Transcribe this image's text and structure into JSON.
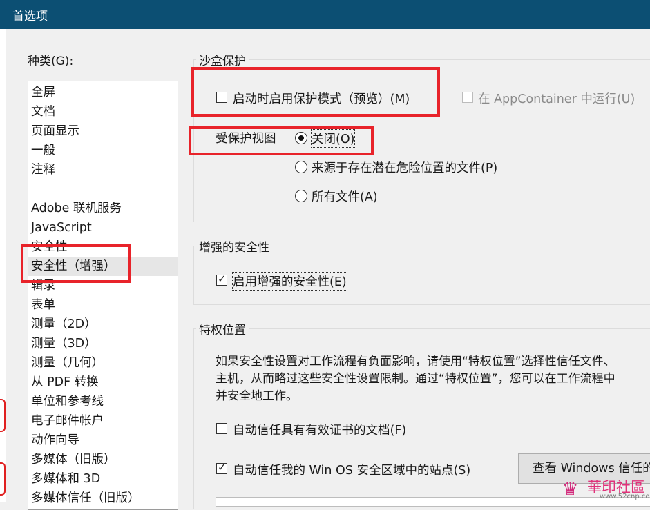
{
  "window": {
    "title": "首选项"
  },
  "categories": {
    "label": "种类(G):",
    "items": [
      "全屏",
      "文档",
      "页面显示",
      "一般",
      "注释",
      "Adobe 联机服务",
      "JavaScript",
      "安全性",
      "安全性（增强）",
      "辑录",
      "表单",
      "测量（2D）",
      "测量（3D）",
      "测量（几何）",
      "从 PDF 转换",
      "单位和参考线",
      "电子邮件帐户",
      "动作向导",
      "多媒体（旧版）",
      "多媒体和 3D",
      "多媒体信任（旧版）"
    ],
    "selected": "安全性（增强）"
  },
  "sandbox": {
    "title": "沙盒保护",
    "protected_mode": {
      "label": "启动时启用保护模式（预览）(M)",
      "checked": false
    },
    "appcontainer": {
      "label": "在 AppContainer 中运行(U)",
      "checked": false,
      "enabled": false
    },
    "protected_view": {
      "label": "受保护视图",
      "options": [
        "关闭(O)",
        "来源于存在潜在危险位置的文件(P)",
        "所有文件(A)"
      ],
      "selected": "关闭(O)"
    }
  },
  "enhanced_security": {
    "title": "增强的安全性",
    "enable": {
      "label": "启用增强的安全性(E)",
      "checked": true
    }
  },
  "privileged": {
    "title": "特权位置",
    "description": [
      "如果安全性设置对工作流程有负面影响，请使用“特权位置”选择性信任文件、",
      "主机，从而略过这些安全性设置限制。通过“特权位置”，您可以在工作流程中",
      "并安全地工作。"
    ],
    "auto_trust_cert": {
      "label": "自动信任具有有效证书的文档(F)",
      "checked": false
    },
    "auto_trust_sites": {
      "label": "自动信任我的 Win OS 安全区域中的站点(S)",
      "checked": true
    },
    "view_button": "查看 Windows 信任的"
  },
  "watermark": {
    "name": "華印社區",
    "site": "www.52cnp.com"
  },
  "colors": {
    "titlebar": "#0c4f73",
    "highlight_box": "#e8232a"
  }
}
